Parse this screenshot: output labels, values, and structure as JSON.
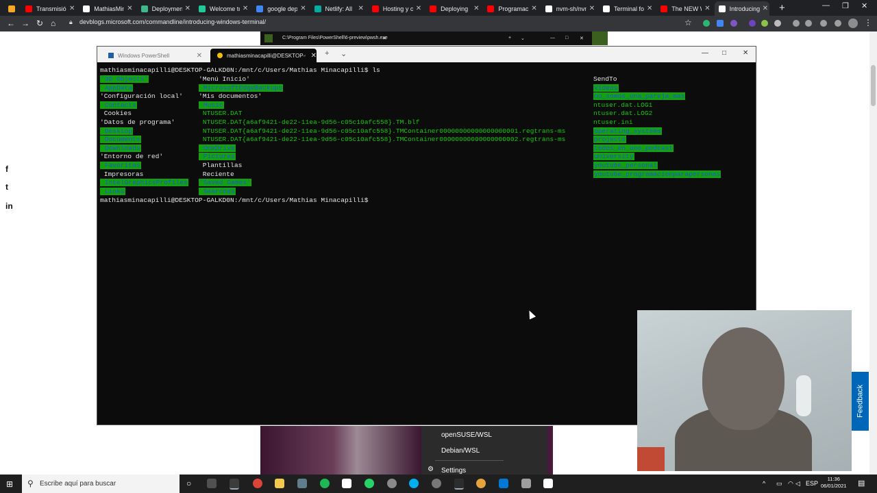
{
  "browser": {
    "tabs": [
      {
        "title": "Transmisión",
        "color": "#ff0000"
      },
      {
        "title": "MathiasMin",
        "color": "#ffffff"
      },
      {
        "title": "Deploymen",
        "color": "#3fb68b"
      },
      {
        "title": "Welcome tc",
        "color": "#20c997"
      },
      {
        "title": "google dep",
        "color": "#4285f4"
      },
      {
        "title": "Netlify: All",
        "color": "#00ad9f"
      },
      {
        "title": "Hosting y cl",
        "color": "#ff0000"
      },
      {
        "title": "Deploying",
        "color": "#ff0000"
      },
      {
        "title": "Programaci",
        "color": "#ff0000"
      },
      {
        "title": "nvm-sh/nvm",
        "color": "#ffffff"
      },
      {
        "title": "Terminal fo",
        "color": "#ffffff"
      },
      {
        "title": "The NEW W",
        "color": "#ff0000"
      },
      {
        "title": "Introducing",
        "color": "#ffffff"
      }
    ],
    "new_tab": "+",
    "url": "devblogs.microsoft.com/commandline/introducing-windows-terminal/"
  },
  "page": {
    "share": [
      "f",
      "t",
      "in"
    ],
    "feedback": "Feedback"
  },
  "pwsh_window": {
    "title": "C:\\Program Files\\PowerShell\\6-preview\\pwsh.exe"
  },
  "terminal": {
    "tabs": [
      {
        "label": "Windows PowerShell",
        "active": false
      },
      {
        "label": "mathiasminacapilli@DESKTOP-C",
        "active": true
      }
    ],
    "prompt": "mathiasminacapilli@DESKTOP-GALKD0N:/mnt/c/Users/Mathias Minacapilli$",
    "command": " ls",
    "col1": [
      {
        "t": "'3D Objects'",
        "hl": true
      },
      {
        "t": " AppData",
        "hl": true
      },
      {
        "t": "'Configuración local'",
        "hl": false
      },
      {
        "t": " Contacts",
        "hl": true
      },
      {
        "t": " Cookies",
        "hl": false
      },
      {
        "t": "'Datos de programa'",
        "hl": false
      },
      {
        "t": " Desktop",
        "hl": true
      },
      {
        "t": " Documents",
        "hl": true
      },
      {
        "t": " Downloads",
        "hl": true
      },
      {
        "t": "'Entorno de red'",
        "hl": false
      },
      {
        "t": " Favorites",
        "hl": true
      },
      {
        "t": " Impresoras",
        "hl": false
      },
      {
        "t": " IntelGraphicsProfiles",
        "hl": true
      },
      {
        "t": " Links",
        "hl": true
      }
    ],
    "col2": [
      {
        "t": "'Menú Inicio'",
        "hl": false
      },
      {
        "t": " MicrosoftEdgeBackups",
        "hl": true
      },
      {
        "t": "'Mis documentos'",
        "hl": false
      },
      {
        "t": " Music",
        "hl": true
      },
      {
        "t": " NTUSER.DAT",
        "hl": false,
        "green": true
      },
      {
        "t": " NTUSER.DAT{a6af9421-de22-11ea-9d56-c05c10afc558}.TM.blf",
        "hl": false,
        "green": true
      },
      {
        "t": " NTUSER.DAT{a6af9421-de22-11ea-9d56-c05c10afc558}.TMContainer00000000000000000001.regtrans-ms",
        "hl": false,
        "green": true
      },
      {
        "t": " NTUSER.DAT{a6af9421-de22-11ea-9d56-c05c10afc558}.TMContainer00000000000000000002.regtrans-ms",
        "hl": false,
        "green": true
      },
      {
        "t": " OneDrive",
        "hl": true
      },
      {
        "t": " Pictures",
        "hl": true
      },
      {
        "t": " Plantillas",
        "hl": false
      },
      {
        "t": " Reciente",
        "hl": false
      },
      {
        "t": "'Saved Games'",
        "hl": true
      },
      {
        "t": " Searches",
        "hl": true
      }
    ],
    "col3": [
      {
        "t": "SendTo",
        "hl": false
      },
      {
        "t": "Videos",
        "hl": true
      },
      {
        "t": "no_somos_una_pareja_mas",
        "hl": true
      },
      {
        "t": "ntuser.dat.LOG1",
        "hl": false,
        "green": true
      },
      {
        "t": "ntuser.dat.LOG2",
        "hl": false,
        "green": true
      },
      {
        "t": "ntuser.ini",
        "hl": false,
        "green": true
      },
      {
        "t": "operating_systems",
        "hl": true
      },
      {
        "t": "projects",
        "hl": true
      },
      {
        "t": "todos_en_uno_podcast",
        "hl": true
      },
      {
        "t": "university",
        "hl": true
      },
      {
        "t": "youtube_personal",
        "hl": true
      },
      {
        "t": "youtube_programacionparapersonas",
        "hl": true
      }
    ]
  },
  "profile_menu": {
    "items": [
      "openSUSE/WSL",
      "Debian/WSL",
      "Settings"
    ]
  },
  "taskbar": {
    "search_placeholder": "Escribe aquí para buscar",
    "lang": "ESP",
    "time": "11:36",
    "date": "06/01/2021"
  }
}
